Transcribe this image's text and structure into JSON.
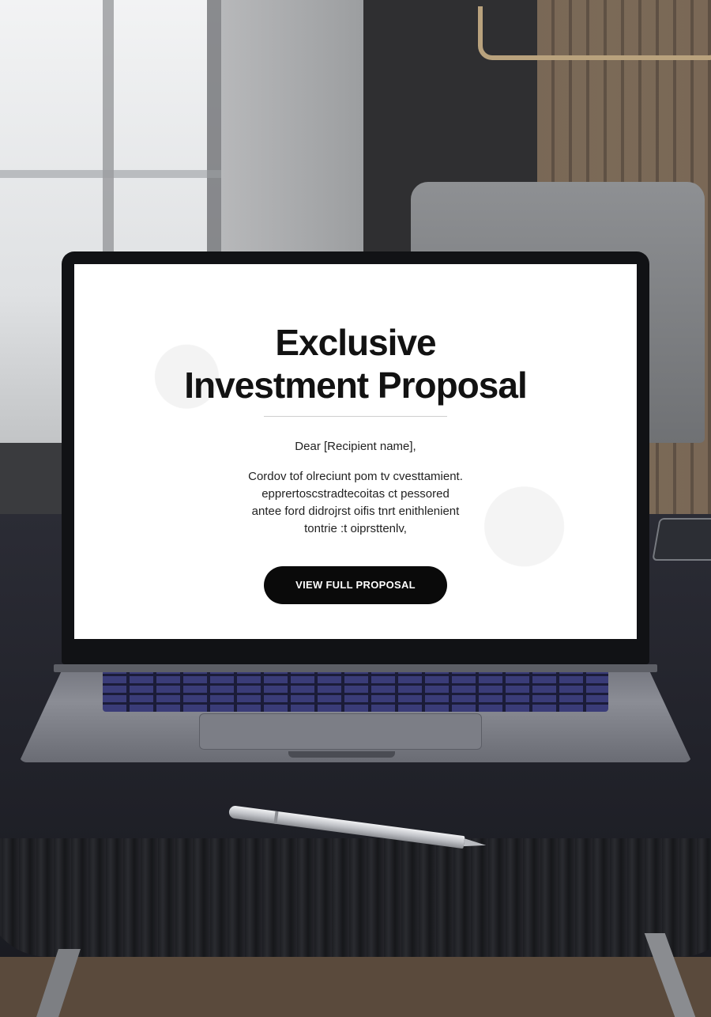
{
  "email": {
    "title_line1": "Exclusive",
    "title_line2": "Investment Proposal",
    "greeting": "Dear [Recipient name],",
    "body_lines": [
      "Cordov tof olreciunt pom tv cvesttamient.",
      "epprertoscstradtecoitas ct pessored",
      "antee ford didrojrst oifis tnrt enithlenient",
      "tontrie :t oiprsttenlv,"
    ],
    "cta_label": "VIEW FULL PROPOSAL"
  },
  "colors": {
    "cta_background": "#0a0a0a",
    "cta_text": "#ffffff",
    "screen_background": "#ffffff",
    "title_text": "#121212"
  }
}
